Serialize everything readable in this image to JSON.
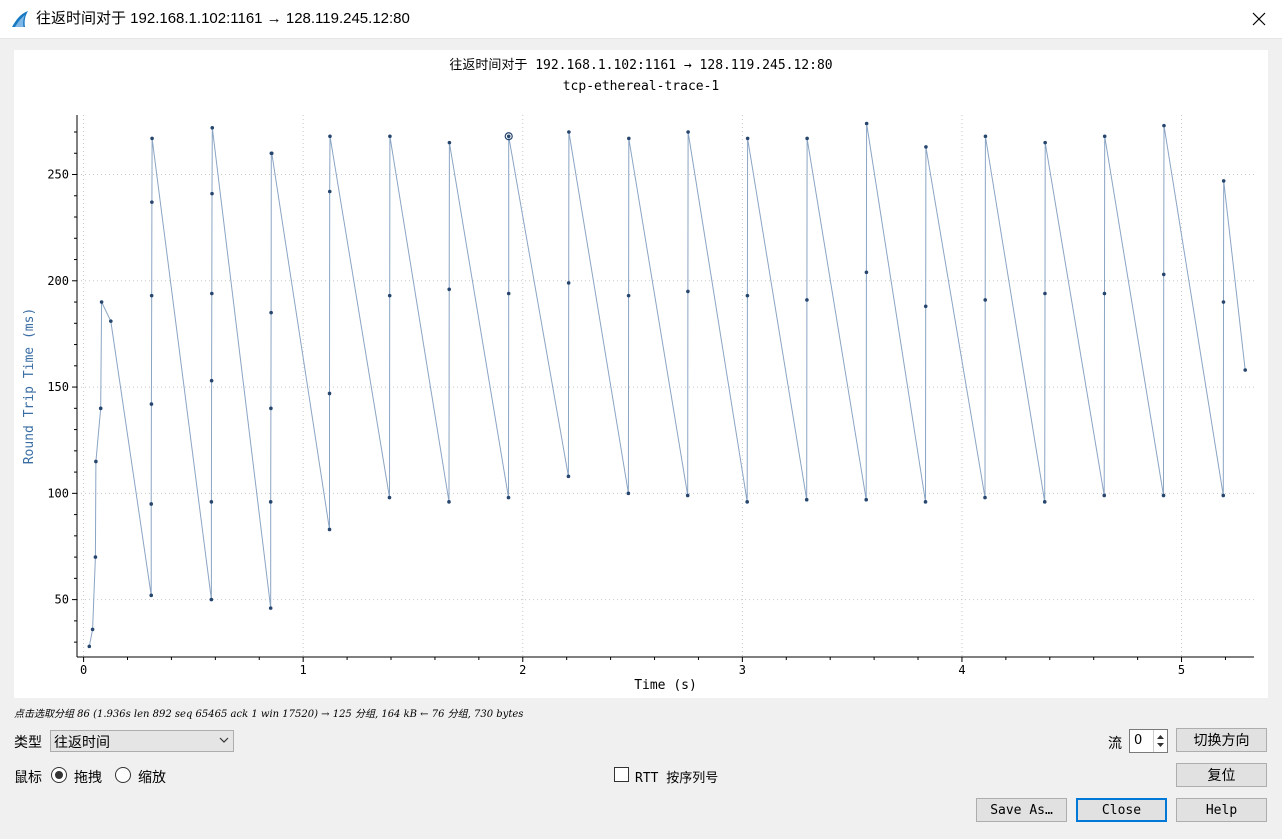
{
  "window": {
    "title": "往返时间对于 192.168.1.102:1161 → 128.119.245.12:80"
  },
  "plot": {
    "title": "往返时间对于 192.168.1.102:1161 → 128.119.245.12:80",
    "subtitle": "tcp-ethereal-trace-1"
  },
  "chart_data": {
    "type": "scatter",
    "title": "往返时间对于 192.168.1.102:1161 → 128.119.245.12:80",
    "subtitle": "tcp-ethereal-trace-1",
    "xlabel": "Time (s)",
    "ylabel": "Round Trip Time (ms)",
    "xlim": [
      -0.03,
      5.33
    ],
    "ylim": [
      23,
      278
    ],
    "xticks": [
      0,
      1,
      2,
      3,
      4,
      5
    ],
    "yticks": [
      50,
      100,
      150,
      200,
      250
    ],
    "grid": true,
    "highlight": {
      "x": 1.936,
      "y": 268
    },
    "series": [
      {
        "color": "#3a6ea5",
        "x": [
          0.026,
          0.041,
          0.054,
          0.056,
          0.078,
          0.082,
          0.124,
          0.308,
          0.308,
          0.309,
          0.31,
          0.311,
          0.312,
          0.582,
          0.582,
          0.583,
          0.584,
          0.585,
          0.586,
          0.852,
          0.852,
          0.853,
          0.854,
          0.855,
          0.857,
          1.12,
          1.12,
          1.121,
          1.122,
          1.393,
          1.394,
          1.395,
          1.664,
          1.665,
          1.666,
          1.935,
          1.936,
          1.936,
          2.208,
          2.209,
          2.21,
          2.481,
          2.482,
          2.483,
          2.751,
          2.752,
          2.753,
          3.022,
          3.023,
          3.024,
          3.293,
          3.294,
          3.295,
          3.564,
          3.565,
          3.566,
          3.834,
          3.835,
          3.836,
          4.105,
          4.106,
          4.107,
          4.377,
          4.378,
          4.379,
          4.648,
          4.649,
          4.65,
          4.918,
          4.919,
          4.92,
          5.19,
          5.191,
          5.192,
          5.29
        ],
        "y": [
          28,
          36,
          70,
          115,
          140,
          190,
          181,
          52,
          95,
          142,
          193,
          237,
          267,
          50,
          96,
          153,
          194,
          241,
          272,
          46,
          96,
          140,
          185,
          260,
          260,
          83,
          147,
          242,
          268,
          98,
          193,
          268,
          96,
          196,
          265,
          98,
          194,
          268,
          108,
          199,
          270,
          100,
          193,
          267,
          99,
          195,
          270,
          96,
          193,
          267,
          97,
          191,
          267,
          97,
          204,
          274,
          96,
          188,
          263,
          98,
          191,
          268,
          96,
          194,
          265,
          99,
          194,
          268,
          99,
          203,
          273,
          99,
          190,
          247,
          158
        ]
      }
    ]
  },
  "hint": "点击选取分组 86 (1.936s len 892 seq 65465 ack 1 win 17520) → 125 分组, 164 kB ← 76 分组, 730 bytes",
  "controls": {
    "type_label": "类型",
    "type_value": "往返时间",
    "mouse_label": "鼠标",
    "drag_label": "拖拽",
    "zoom_label": "缩放",
    "rtt_label": "RTT 按序列号",
    "stream_label": "流",
    "stream_value": "0",
    "switch_direction": "切换方向",
    "reset": "复位",
    "save_as": "Save As…",
    "close": "Close",
    "help": "Help"
  }
}
